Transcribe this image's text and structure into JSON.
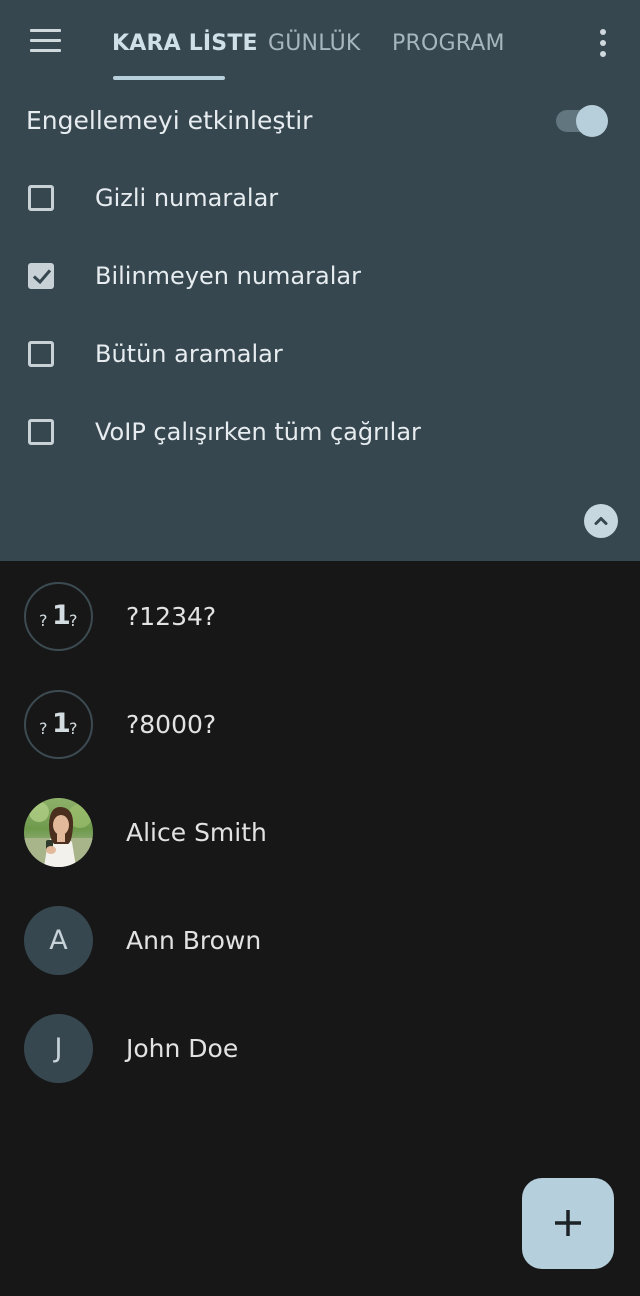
{
  "header": {
    "tabs": [
      {
        "label": "KARA LİSTE",
        "active": true
      },
      {
        "label": "GÜNLÜK",
        "active": false
      },
      {
        "label": "PROGRAM",
        "active": false
      }
    ],
    "menu_icon": "hamburger-menu-icon",
    "overflow_icon": "more-vertical-icon"
  },
  "blocking": {
    "enable_label": "Engellemeyi etkinleştir",
    "enabled": true,
    "options": [
      {
        "label": "Gizli numaralar",
        "checked": false
      },
      {
        "label": "Bilinmeyen numaralar",
        "checked": true
      },
      {
        "label": "Bütün aramalar",
        "checked": false
      },
      {
        "label": "VoIP çalışırken tüm çağrılar",
        "checked": false
      }
    ],
    "collapse_icon": "chevron-up-icon"
  },
  "contacts": [
    {
      "name": "?1234?",
      "avatar_type": "unknown",
      "avatar_text": "1",
      "avatar_marks": "?"
    },
    {
      "name": "?8000?",
      "avatar_type": "unknown",
      "avatar_text": "1",
      "avatar_marks": "?"
    },
    {
      "name": "Alice Smith",
      "avatar_type": "photo"
    },
    {
      "name": "Ann Brown",
      "avatar_type": "letter",
      "avatar_text": "A"
    },
    {
      "name": "John Doe",
      "avatar_type": "letter",
      "avatar_text": "J"
    }
  ],
  "fab_icon": "plus-icon",
  "colors": {
    "header_bg": "#37474f",
    "list_bg": "#171717",
    "accent": "#b6cfdc"
  }
}
